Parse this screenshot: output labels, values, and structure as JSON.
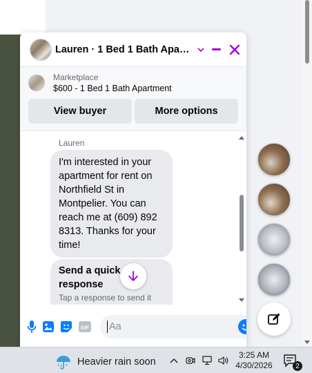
{
  "chat": {
    "title": "Lauren · 1 Bed 1 Bath Apart…",
    "listing": {
      "label": "Marketplace",
      "title": "$600 - 1 Bed 1 Bath Apartment",
      "view_buyer": "View buyer",
      "more_options": "More options"
    },
    "messages": {
      "sender": "Lauren",
      "text": "I'm interested in your apartment for rent on Northfield St in Montpelier. You can reach me at (609) 892 8313. Thanks for your time!",
      "quick_title": "Send a quick response",
      "quick_sub": "Tap a response to send it"
    },
    "composer": {
      "placeholder": "Aa",
      "icons": [
        "microphone-icon",
        "photo-icon",
        "sticker-icon",
        "gif-icon",
        "emoji-icon",
        "thumbs-up-icon"
      ]
    },
    "accent_color": "#a100d6",
    "brand_color": "#0a7cff"
  },
  "taskbar": {
    "weather": "Heavier rain soon",
    "time": "3:25 AM",
    "date": "4/30/2026",
    "notification_count": "2"
  }
}
